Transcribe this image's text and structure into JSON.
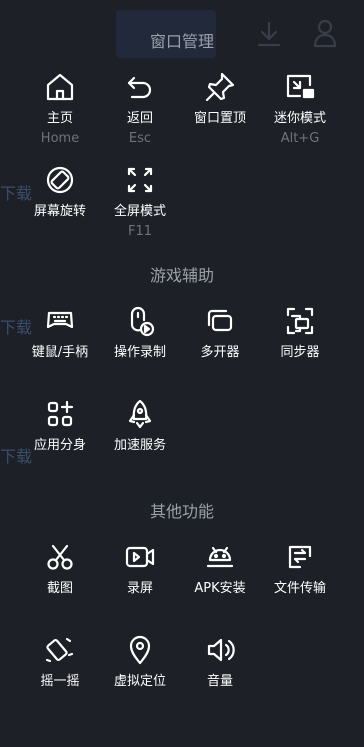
{
  "sections": {
    "window": "窗口管理",
    "game": "游戏辅助",
    "other": "其他功能"
  },
  "window_items": [
    {
      "label": "主页",
      "sub": "Home",
      "icon": "home-icon"
    },
    {
      "label": "返回",
      "sub": "Esc",
      "icon": "back-icon"
    },
    {
      "label": "窗口置顶",
      "sub": "",
      "icon": "pin-icon"
    },
    {
      "label": "迷你模式",
      "sub": "Alt+G",
      "icon": "mini-mode-icon"
    },
    {
      "label": "屏幕旋转",
      "sub": "",
      "icon": "rotate-icon"
    },
    {
      "label": "全屏模式",
      "sub": "F11",
      "icon": "fullscreen-icon"
    }
  ],
  "game_items": [
    {
      "label": "键鼠/手柄",
      "icon": "gamepad-icon"
    },
    {
      "label": "操作录制",
      "icon": "record-macro-icon"
    },
    {
      "label": "多开器",
      "icon": "multi-instance-icon"
    },
    {
      "label": "同步器",
      "icon": "sync-icon"
    },
    {
      "label": "应用分身",
      "icon": "app-clone-icon"
    },
    {
      "label": "加速服务",
      "icon": "rocket-icon"
    }
  ],
  "other_items": [
    {
      "label": "截图",
      "icon": "scissors-icon"
    },
    {
      "label": "录屏",
      "icon": "screen-record-icon"
    },
    {
      "label": "APK安装",
      "icon": "android-icon"
    },
    {
      "label": "文件传输",
      "icon": "file-transfer-icon"
    },
    {
      "label": "摇一摇",
      "icon": "shake-icon"
    },
    {
      "label": "虚拟定位",
      "icon": "location-icon"
    },
    {
      "label": "音量",
      "icon": "volume-icon"
    }
  ],
  "background": {
    "ghost_label": "下载"
  }
}
